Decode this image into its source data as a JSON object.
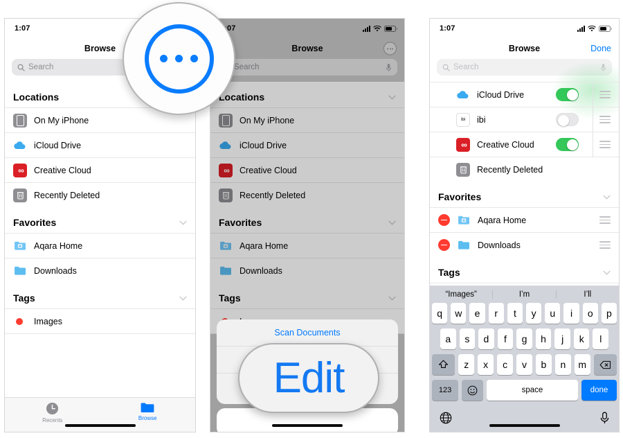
{
  "status": {
    "time": "1:07",
    "location_arrow_icon": "location-arrow-icon",
    "signal_icon": "cellular-bars-icon",
    "wifi_icon": "wifi-icon",
    "battery_icon": "battery-icon"
  },
  "nav": {
    "title": "Browse",
    "more_icon": "ellipsis-circle-icon",
    "done_label": "Done"
  },
  "search": {
    "placeholder": "Search",
    "search_icon": "search-icon",
    "mic_icon": "microphone-icon"
  },
  "sections": {
    "locations": "Locations",
    "favorites": "Favorites",
    "tags": "Tags"
  },
  "locations_items": [
    {
      "label": "On My iPhone",
      "icon": "iphone-icon"
    },
    {
      "label": "iCloud Drive",
      "icon": "icloud-icon"
    },
    {
      "label": "Creative Cloud",
      "icon": "creative-cloud-icon"
    },
    {
      "label": "Recently Deleted",
      "icon": "trash-icon"
    }
  ],
  "favorites_items": [
    {
      "label": "Aqara Home",
      "icon": "folder-icon"
    },
    {
      "label": "Downloads",
      "icon": "folder-icon"
    }
  ],
  "tags_items": [
    {
      "label": "Images",
      "icon": "red-dot-icon"
    }
  ],
  "edit_locations_items": [
    {
      "label": "iCloud Drive",
      "icon": "icloud-icon",
      "toggle": "on"
    },
    {
      "label": "ibi",
      "icon": "ibi-icon",
      "toggle": "off"
    },
    {
      "label": "Creative Cloud",
      "icon": "creative-cloud-icon",
      "toggle": "on"
    },
    {
      "label": "Recently Deleted",
      "icon": "trash-icon",
      "toggle": "none"
    }
  ],
  "edit_favorites_items": [
    {
      "label": "Aqara Home",
      "icon": "folder-icon"
    },
    {
      "label": "Downloads",
      "icon": "folder-icon"
    }
  ],
  "edit_tags_items": [
    {
      "label": "Images",
      "icon": "red-dot-icon"
    }
  ],
  "tabbar": {
    "recents_label": "Recents",
    "recents_icon": "clock-icon",
    "browse_label": "Browse",
    "browse_icon": "folder-icon"
  },
  "action_sheet": {
    "scan_label": "Scan Documents",
    "row2_label": "",
    "row3_label": "",
    "cancel_label": ""
  },
  "magnifier": {
    "more_icon": "ellipsis-circle-icon",
    "edit_label": "Edit"
  },
  "keyboard": {
    "predictions": [
      "“Images”",
      "I’m",
      "I’ll"
    ],
    "row1": [
      "q",
      "w",
      "e",
      "r",
      "t",
      "y",
      "u",
      "i",
      "o",
      "p"
    ],
    "row2": [
      "a",
      "s",
      "d",
      "f",
      "g",
      "h",
      "j",
      "k",
      "l"
    ],
    "row3": [
      "z",
      "x",
      "c",
      "v",
      "b",
      "n",
      "m"
    ],
    "shift_icon": "shift-arrow-icon",
    "backspace_icon": "backspace-icon",
    "numbers_label": "123",
    "emoji_icon": "smiley-icon",
    "space_label": "space",
    "done_label": "done",
    "globe_icon": "globe-icon",
    "mic_icon": "microphone-icon"
  },
  "colors": {
    "accent_blue": "#007aff",
    "toggle_green": "#34c759",
    "delete_red": "#ff3b30",
    "creative_cloud_red": "#da1f26"
  }
}
